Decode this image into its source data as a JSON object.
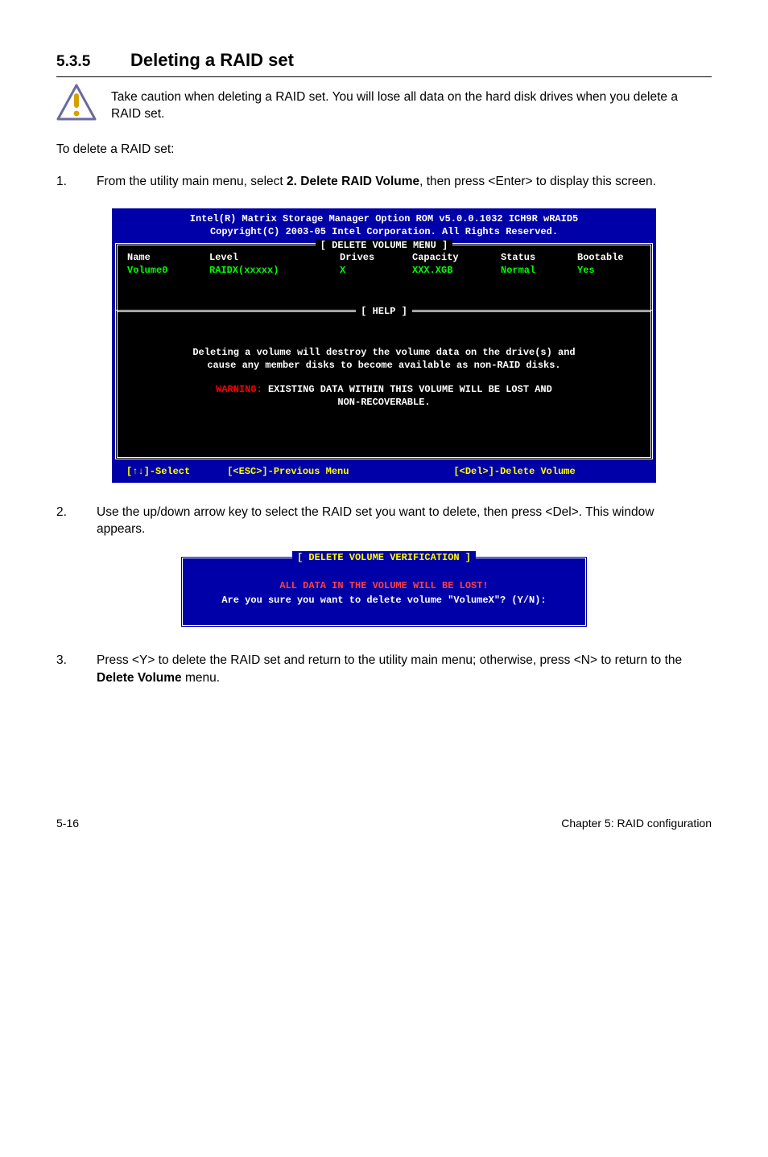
{
  "section": {
    "number": "5.3.5",
    "title": "Deleting a RAID set"
  },
  "caution": {
    "text": "Take caution when deleting a RAID set. You will lose all data on the hard disk drives when you delete a RAID set."
  },
  "intro": "To delete a RAID set:",
  "steps": {
    "s1": {
      "num": "1.",
      "pre": "From the utility main menu, select ",
      "bold": "2. Delete RAID Volume",
      "post": ", then press <Enter> to display this screen."
    },
    "s2": {
      "num": "2.",
      "text": "Use the up/down arrow key to select the RAID set you want to delete, then press <Del>. This window appears."
    },
    "s3": {
      "num": "3.",
      "pre": "Press <Y> to delete the RAID set and return to the utility main menu; otherwise, press <N> to return to the ",
      "bold": "Delete Volume",
      "post": " menu."
    }
  },
  "bios": {
    "header1": "Intel(R) Matrix Storage Manager Option ROM v5.0.0.1032 ICH9R wRAID5",
    "header2": "Copyright(C) 2003-05 Intel Corporation. All Rights Reserved.",
    "menuTitle": "[ DELETE VOLUME MENU ]",
    "cols": {
      "name": "Name",
      "level": "Level",
      "drives": "Drives",
      "capacity": "Capacity",
      "status": "Status",
      "bootable": "Bootable"
    },
    "row": {
      "name": "Volume0",
      "level": "RAIDX(xxxxx)",
      "drives": "X",
      "capacity": "XXX.XGB",
      "status": "Normal",
      "bootable": "Yes"
    },
    "helpTitle": "[ HELP ]",
    "help": {
      "l1": "Deleting a volume will destroy the volume data on the drive(s) and",
      "l2": "cause any member disks to become available as non-RAID disks.",
      "warnLabel": "WARNING:",
      "warnRest": " EXISTING DATA WITHIN THIS VOLUME WILL BE LOST AND",
      "l4": "NON-RECOVERABLE."
    },
    "footer": {
      "f1": "[↑↓]-Select",
      "f2": "[<ESC>]-Previous Menu",
      "f3": "[<Del>]-Delete Volume"
    }
  },
  "dialog": {
    "title": "[ DELETE VOLUME VERIFICATION ]",
    "red": "ALL DATA IN THE VOLUME WILL BE LOST!",
    "prompt": "Are you sure you want to delete volume \"VolumeX\"? (Y/N):"
  },
  "footer": {
    "left": "5-16",
    "right": "Chapter 5: RAID configuration"
  }
}
